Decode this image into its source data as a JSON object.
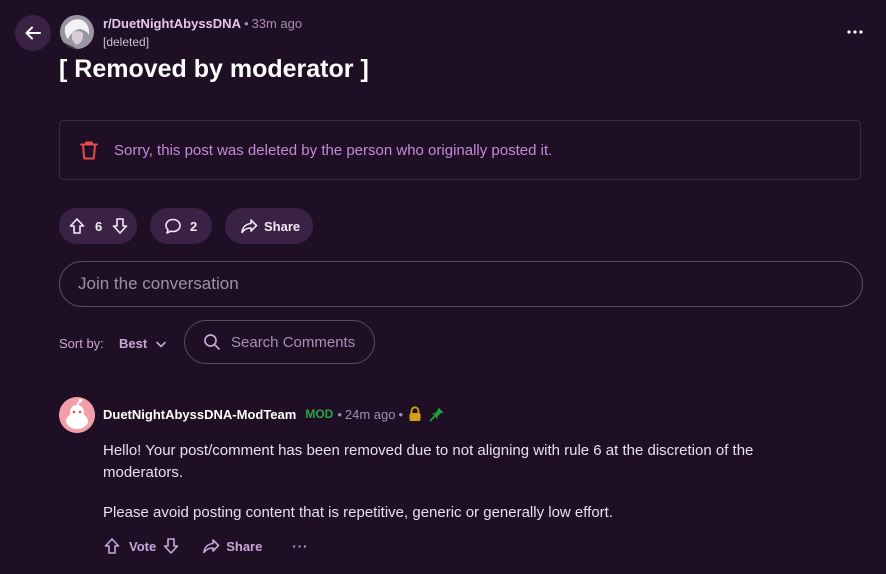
{
  "header": {
    "subreddit": "r/DuetNightAbyssDNA",
    "separator": "•",
    "post_time": "33m ago",
    "author": "[deleted]"
  },
  "post": {
    "title": "[ Removed by moderator ]",
    "notice": "Sorry, this post was deleted by the person who originally posted it.",
    "vote_count": "6",
    "comment_count": "2",
    "share_label": "Share"
  },
  "composer": {
    "placeholder": "Join the conversation"
  },
  "sort": {
    "label": "Sort by:",
    "value": "Best"
  },
  "search": {
    "placeholder": "Search Comments"
  },
  "comment": {
    "author": "DuetNightAbyssDNA-ModTeam",
    "mod_badge": "MOD",
    "separator": "•",
    "time": "24m ago",
    "body_p1": "Hello! Your post/comment has been removed due to not aligning with rule 6 at the discretion of the moderators.",
    "body_p2": "Please avoid posting content that is repetitive, generic or generally low effort.",
    "vote_label": "Vote",
    "share_label": "Share",
    "more_label": "···"
  },
  "colors": {
    "background": "#1f0f25",
    "pill": "#3a2245",
    "accent_text": "#c8a6d8",
    "notice_text": "#c58ad6",
    "trash_red": "#e5484d",
    "mod_green": "#2aa44a",
    "lock_gold": "#d4a017",
    "pin_green": "#1f9e3a"
  },
  "icons": [
    "back-arrow-icon",
    "more-horizontal-icon",
    "trash-icon",
    "upvote-icon",
    "downvote-icon",
    "comment-icon",
    "share-icon",
    "chevron-down-icon",
    "search-icon",
    "lock-icon",
    "pin-icon"
  ]
}
